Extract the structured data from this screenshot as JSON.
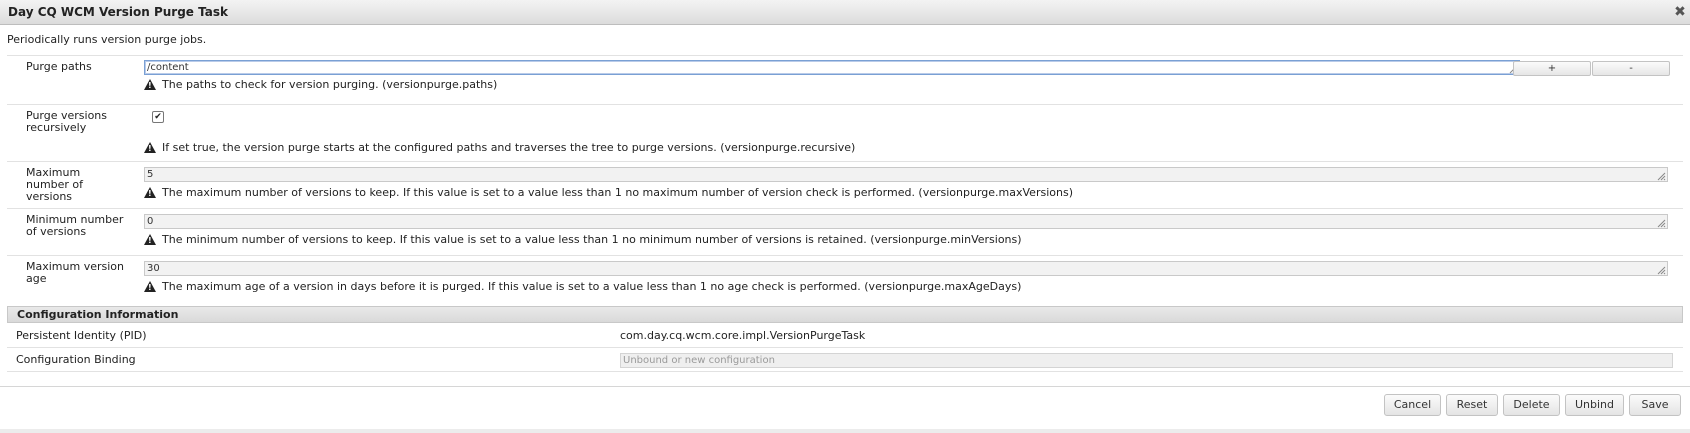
{
  "dialog": {
    "title": "Day CQ WCM Version Purge Task",
    "close_icon": "close-icon",
    "description": "Periodically runs version purge jobs."
  },
  "fields": {
    "purge_paths": {
      "label": "Purge paths",
      "value": "/content",
      "hint": "The paths to check for version purging. (versionpurge.paths)",
      "add_label": "+",
      "remove_label": "-"
    },
    "purge_recursive": {
      "label": "Purge versions recursively",
      "checked": true,
      "check_glyph": "✔",
      "hint": "If set true, the version purge starts at the configured paths and traverses the tree to purge versions. (versionpurge.recursive)"
    },
    "max_versions": {
      "label": "Maximum number of versions",
      "value": "5",
      "hint": "The maximum number of versions to keep. If this value is set to a value less than 1 no maximum number of version check is performed. (versionpurge.maxVersions)"
    },
    "min_versions": {
      "label": "Minimum number of versions",
      "value": "0",
      "hint": "The minimum number of versions to keep. If this value is set to a value less than 1 no minimum number of versions is retained. (versionpurge.minVersions)"
    },
    "max_age": {
      "label": "Maximum version age",
      "value": "30",
      "hint": "The maximum age of a version in days before it is purged. If this value is set to a value less than 1 no age check is performed. (versionpurge.maxAgeDays)"
    }
  },
  "config_info": {
    "header": "Configuration Information",
    "pid_label": "Persistent Identity (PID)",
    "pid_value": "com.day.cq.wcm.core.impl.VersionPurgeTask",
    "binding_label": "Configuration Binding",
    "binding_placeholder": "Unbound or new configuration"
  },
  "buttons": {
    "cancel": "Cancel",
    "reset": "Reset",
    "delete": "Delete",
    "unbind": "Unbind",
    "save": "Save"
  },
  "icons": {
    "warning": "warning-icon",
    "resize": "resize-handle-icon"
  },
  "colors": {
    "active_border": "#7aa0d4",
    "titlebar_top": "#f3f3f3",
    "titlebar_bottom": "#dcdcdc"
  }
}
